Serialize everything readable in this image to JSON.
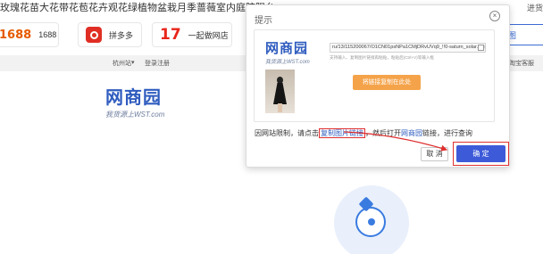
{
  "background": {
    "page_title": "玫瑰花苗大花带花苞花卉观花绿植物盆栽月季蔷薇室内庭院阳台",
    "top_right_tab": "进货",
    "platforms": [
      {
        "logo": "1688",
        "label": "1688"
      },
      {
        "logo": "pinduoduo",
        "label": "拼多多"
      },
      {
        "logo": "17",
        "label": "一起做网店"
      }
    ],
    "right_tab_label": "图",
    "nav": {
      "city": "杭州站",
      "arrow": "▾",
      "login": "登录",
      "register": "注册",
      "right_link": "淘宝客服"
    },
    "logo_text": "网商园",
    "logo_tagline": "我货源上WST.com"
  },
  "dialog": {
    "title": "提示",
    "close_icon": "×",
    "logo_text": "网商园",
    "logo_tagline": "我货源上WST.com",
    "url_value": "ru/13/115200067/O1CN01psNPa1CMjDRvUVq9_!!0-saturn_solar.jpg",
    "hint": "支持输入、复制图片链接再粘贴，粘贴后(Ctrl+V)等输入框",
    "paste_label": "将链接复制在此处",
    "instruction_prefix": "因网站限制，请点击",
    "instruction_link": "复制图片链接",
    "instruction_mid": "，然后打开",
    "instruction_site": "网商园",
    "instruction_suffix": "链接，进行查询",
    "cancel_label": "取 消",
    "confirm_label": "确 定"
  },
  "colors": {
    "accent": "#3d5bd9",
    "highlight": "#e03030",
    "paste": "#f5a34a"
  }
}
